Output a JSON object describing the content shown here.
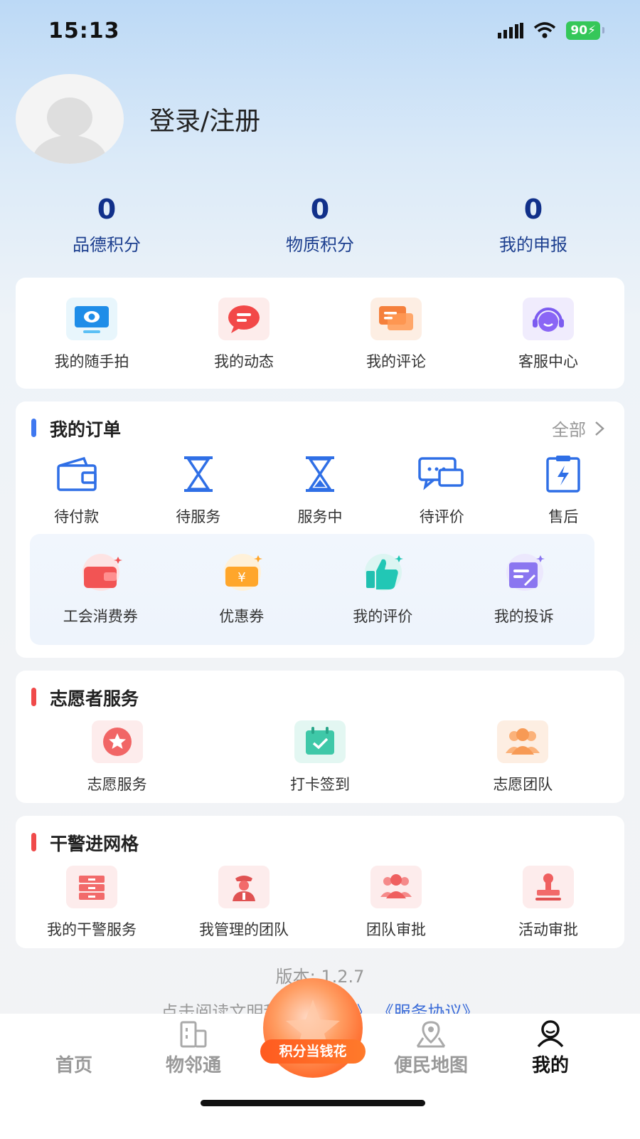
{
  "status": {
    "time": "15:13",
    "battery": "90"
  },
  "profile": {
    "login_label": "登录/注册"
  },
  "stats": [
    {
      "value": "0",
      "label": "品德积分"
    },
    {
      "value": "0",
      "label": "物质积分"
    },
    {
      "value": "0",
      "label": "我的申报"
    }
  ],
  "quick": [
    {
      "label": "我的随手拍",
      "icon": "camera-icon"
    },
    {
      "label": "我的动态",
      "icon": "message-icon"
    },
    {
      "label": "我的评论",
      "icon": "comment-icon"
    },
    {
      "label": "客服中心",
      "icon": "headset-icon"
    }
  ],
  "orders": {
    "title": "我的订单",
    "more": "全部",
    "items": [
      {
        "label": "待付款",
        "icon": "wallet-icon"
      },
      {
        "label": "待服务",
        "icon": "hourglass-icon"
      },
      {
        "label": "服务中",
        "icon": "hourglass-running-icon"
      },
      {
        "label": "待评价",
        "icon": "chat-icon"
      },
      {
        "label": "售后",
        "icon": "clipboard-icon"
      }
    ],
    "sub": [
      {
        "label": "工会消费券",
        "icon": "wallet-coupon-icon"
      },
      {
        "label": "优惠券",
        "icon": "coupon-icon"
      },
      {
        "label": "我的评价",
        "icon": "thumbs-up-icon"
      },
      {
        "label": "我的投诉",
        "icon": "complaint-icon"
      }
    ]
  },
  "volunteer": {
    "title": "志愿者服务",
    "items": [
      {
        "label": "志愿服务",
        "icon": "star-icon"
      },
      {
        "label": "打卡签到",
        "icon": "calendar-check-icon"
      },
      {
        "label": "志愿团队",
        "icon": "team-icon"
      }
    ]
  },
  "police": {
    "title": "干警进网格",
    "items": [
      {
        "label": "我的干警服务",
        "icon": "drawer-icon"
      },
      {
        "label": "我管理的团队",
        "icon": "officer-icon"
      },
      {
        "label": "团队审批",
        "icon": "group-icon"
      },
      {
        "label": "活动审批",
        "icon": "stamp-icon"
      }
    ]
  },
  "footer": {
    "version": "版本: 1.2.7",
    "read_prefix": "点击阅读文明积分",
    "link1": "《…策》",
    "link2": "《服务协议》"
  },
  "tabs": [
    {
      "label": "首页"
    },
    {
      "label": "物邻通"
    },
    {
      "label": "积分当钱花"
    },
    {
      "label": "便民地图"
    },
    {
      "label": "我的"
    }
  ],
  "colors": {
    "accent_blue": "#3f78f0",
    "bar_red": "#f04a4a",
    "stat_blue": "#11308a"
  }
}
